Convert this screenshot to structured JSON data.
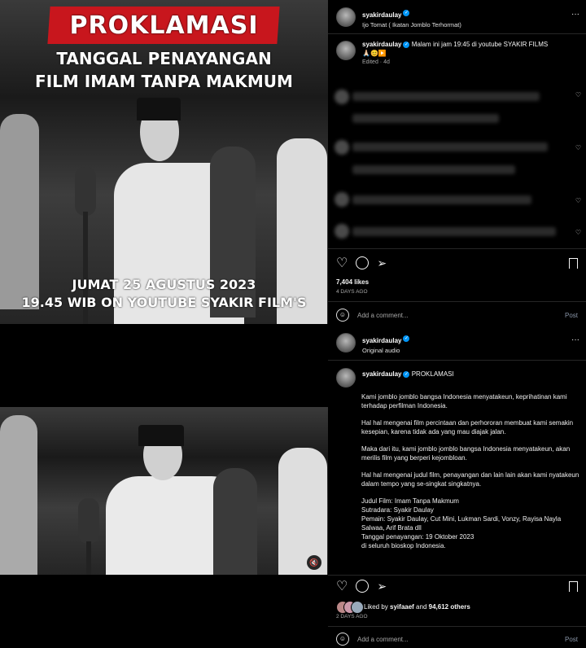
{
  "post1": {
    "poster": {
      "banner": "PROKLAMASI",
      "line1": "TANGGAL PENAYANGAN",
      "line2": "FILM IMAM TANPA MAKMUM",
      "date": "JUMAT 25 AGUSTUS 2023",
      "time": "19.45 WIB ON YOUTUBE SYAKIR FILM'S"
    },
    "header": {
      "username": "syakirdaulay",
      "subtitle": "Ijo Tomat ( Ikatan Jomblo Terhormat)"
    },
    "caption": {
      "username": "syakirdaulay",
      "text": "Malam ini jam 19:45 di youtube SYAKIR FILMS",
      "emojis": "🙏🏻😊▶️",
      "meta": "Edited · 4d"
    },
    "likes": "7,404 likes",
    "time_ago": "4 DAYS AGO",
    "add_comment_placeholder": "Add a comment...",
    "post_label": "Post",
    "more_label": "···"
  },
  "post2": {
    "header": {
      "username": "syakirdaulay",
      "subtitle": "Original audio"
    },
    "caption": {
      "username": "syakirdaulay",
      "title": "PROKLAMASI",
      "paragraphs": [
        "Kami jomblo jomblo bangsa Indonesia menyatakeun, keprihatinan kami terhadap perfilman Indonesia.",
        "Hal hal mengenai film percintaan dan perhororan membuat kami semakin kesepian, karena tidak ada yang mau diajak jalan.",
        "Maka dari itu, kami jomblo jomblo bangsa Indonesia menyatakeun, akan merilis film yang berperi kejombloan.",
        "Hal hal mengenai judul film, penayangan dan lain lain akan kami nyatakeun dalam tempo yang se-singkat singkatnya."
      ],
      "details": [
        "Judul Film: Imam Tanpa Makmum",
        "Sutradara: Syakir Daulay",
        "Pemain: Syakir Daulay, Cut Mini, Lukman Sardi, Vonzy, Rayisa Nayla Salwaa, Arif Brata dll",
        "Tanggal penayangan: 19 Oktober 2023",
        "di seluruh bioskop Indonesia."
      ]
    },
    "liked_by_prefix": "Liked by ",
    "liked_by_user": "syifaaef",
    "liked_by_and": " and ",
    "liked_by_others": "94,612 others",
    "time_ago": "2 DAYS AGO",
    "add_comment_placeholder": "Add a comment...",
    "post_label": "Post",
    "more_label": "···"
  },
  "colors": {
    "accent_blue": "#0095f6",
    "banner_red": "#c8161d",
    "post_link": "#8a96a8"
  },
  "icons": [
    "heart-icon",
    "comment-icon",
    "share-icon",
    "bookmark-icon",
    "emoji-icon",
    "mute-icon",
    "verified-icon"
  ]
}
